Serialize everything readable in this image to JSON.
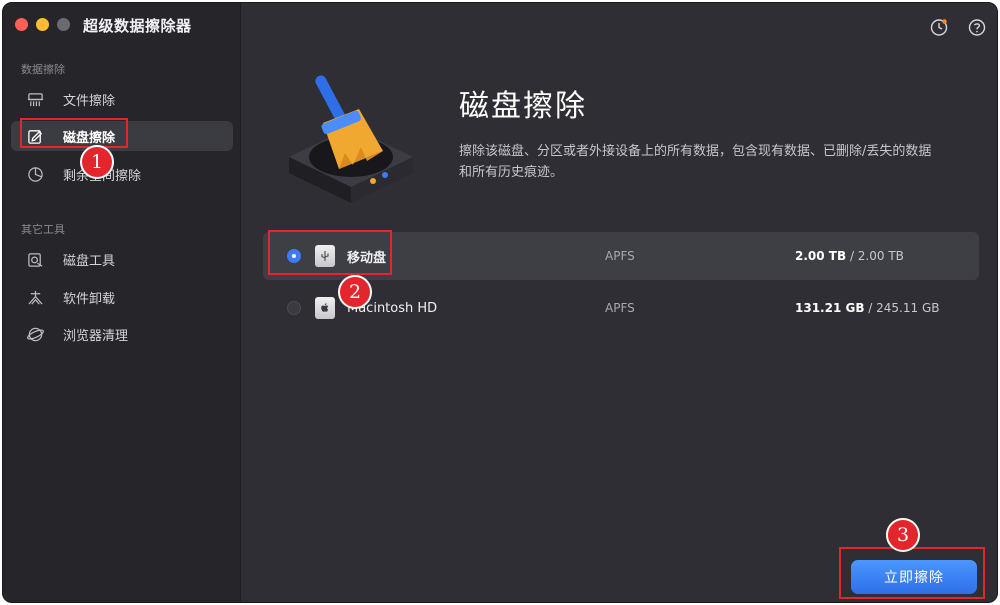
{
  "window": {
    "title": "超级数据擦除器"
  },
  "sidebar": {
    "section1_label": "数据擦除",
    "section2_label": "其它工具",
    "items": [
      {
        "label": "文件擦除",
        "icon": "shredder-icon"
      },
      {
        "label": "磁盘擦除",
        "icon": "disk-erase-icon",
        "active": true
      },
      {
        "label": "剩余空间擦除",
        "icon": "pie-chart-icon"
      },
      {
        "label": "磁盘工具",
        "icon": "disk-tool-icon"
      },
      {
        "label": "软件卸载",
        "icon": "uninstall-icon"
      },
      {
        "label": "浏览器清理",
        "icon": "browser-icon"
      }
    ]
  },
  "header": {
    "history_icon": "history-clock-icon",
    "help_icon": "help-icon"
  },
  "hero": {
    "title": "磁盘擦除",
    "description": "擦除该磁盘、分区或者外接设备上的所有数据，包含现有数据、已删除/丢失的数据和所有历史痕迹。"
  },
  "disks": [
    {
      "name": "移动盘",
      "fs": "APFS",
      "used": "2.00 TB",
      "total": "2.00 TB",
      "selected": true,
      "icon": "usb-drive-icon"
    },
    {
      "name": "Macintosh HD",
      "fs": "APFS",
      "used": "131.21 GB",
      "total": "245.11 GB",
      "selected": false,
      "icon": "apple-drive-icon"
    }
  ],
  "size_separator": " / ",
  "action": {
    "erase_now_label": "立即擦除"
  },
  "annotations": [
    "1",
    "2",
    "3"
  ],
  "colors": {
    "accent": "#3d7cf5",
    "annotation": "#e3262c",
    "window_bg": "#2e2e34",
    "sidebar_bg": "#25252a"
  }
}
